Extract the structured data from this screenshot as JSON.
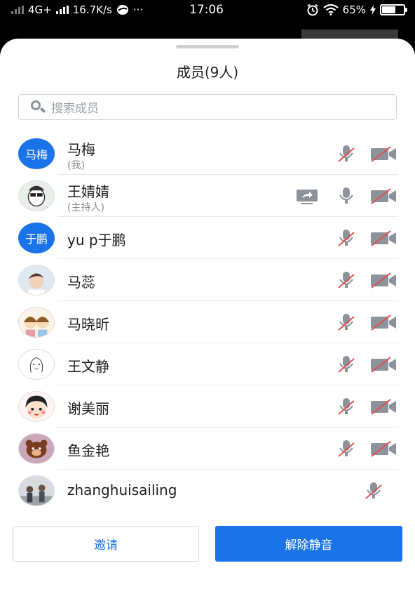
{
  "status_bar": {
    "network": "4G+",
    "speed": "16.7K/s",
    "more": "···",
    "time": "17:06",
    "battery": "65%",
    "battery_level": 0.65
  },
  "sheet": {
    "title": "成员(9人)",
    "search": {
      "placeholder": "搜索成员"
    }
  },
  "members": [
    {
      "name": "马梅",
      "sub": "(我)",
      "avatar_text": "马梅",
      "avatar": "text",
      "mic": "muted",
      "cam": "off",
      "share": false
    },
    {
      "name": "王婧婧",
      "sub": "(主持人)",
      "avatar": "photo",
      "mic": "on",
      "cam": "off",
      "share": true
    },
    {
      "name": "yu p于鹏",
      "sub": "",
      "avatar_text": "于鹏",
      "avatar": "text",
      "mic": "muted",
      "cam": "off",
      "share": false
    },
    {
      "name": "马蕊",
      "sub": "",
      "avatar": "photo",
      "mic": "muted",
      "cam": "off",
      "share": false
    },
    {
      "name": "马晓昕",
      "sub": "",
      "avatar": "photo",
      "mic": "muted",
      "cam": "off",
      "share": false
    },
    {
      "name": "王文静",
      "sub": "",
      "avatar": "photo",
      "mic": "muted",
      "cam": "off",
      "share": false
    },
    {
      "name": "谢美丽",
      "sub": "",
      "avatar": "photo",
      "mic": "muted",
      "cam": "off",
      "share": false
    },
    {
      "name": "鱼金艳",
      "sub": "",
      "avatar": "photo",
      "mic": "muted",
      "cam": "off",
      "share": false
    },
    {
      "name": "zhanghuisailing",
      "sub": "",
      "avatar": "photo",
      "mic": "muted",
      "cam": "none",
      "share": false
    }
  ],
  "footer": {
    "invite_label": "邀请",
    "unmute_label": "解除静音"
  },
  "colors": {
    "accent": "#1a73e8",
    "muted_slash": "#e05050",
    "icon_gray": "#8d939b"
  }
}
